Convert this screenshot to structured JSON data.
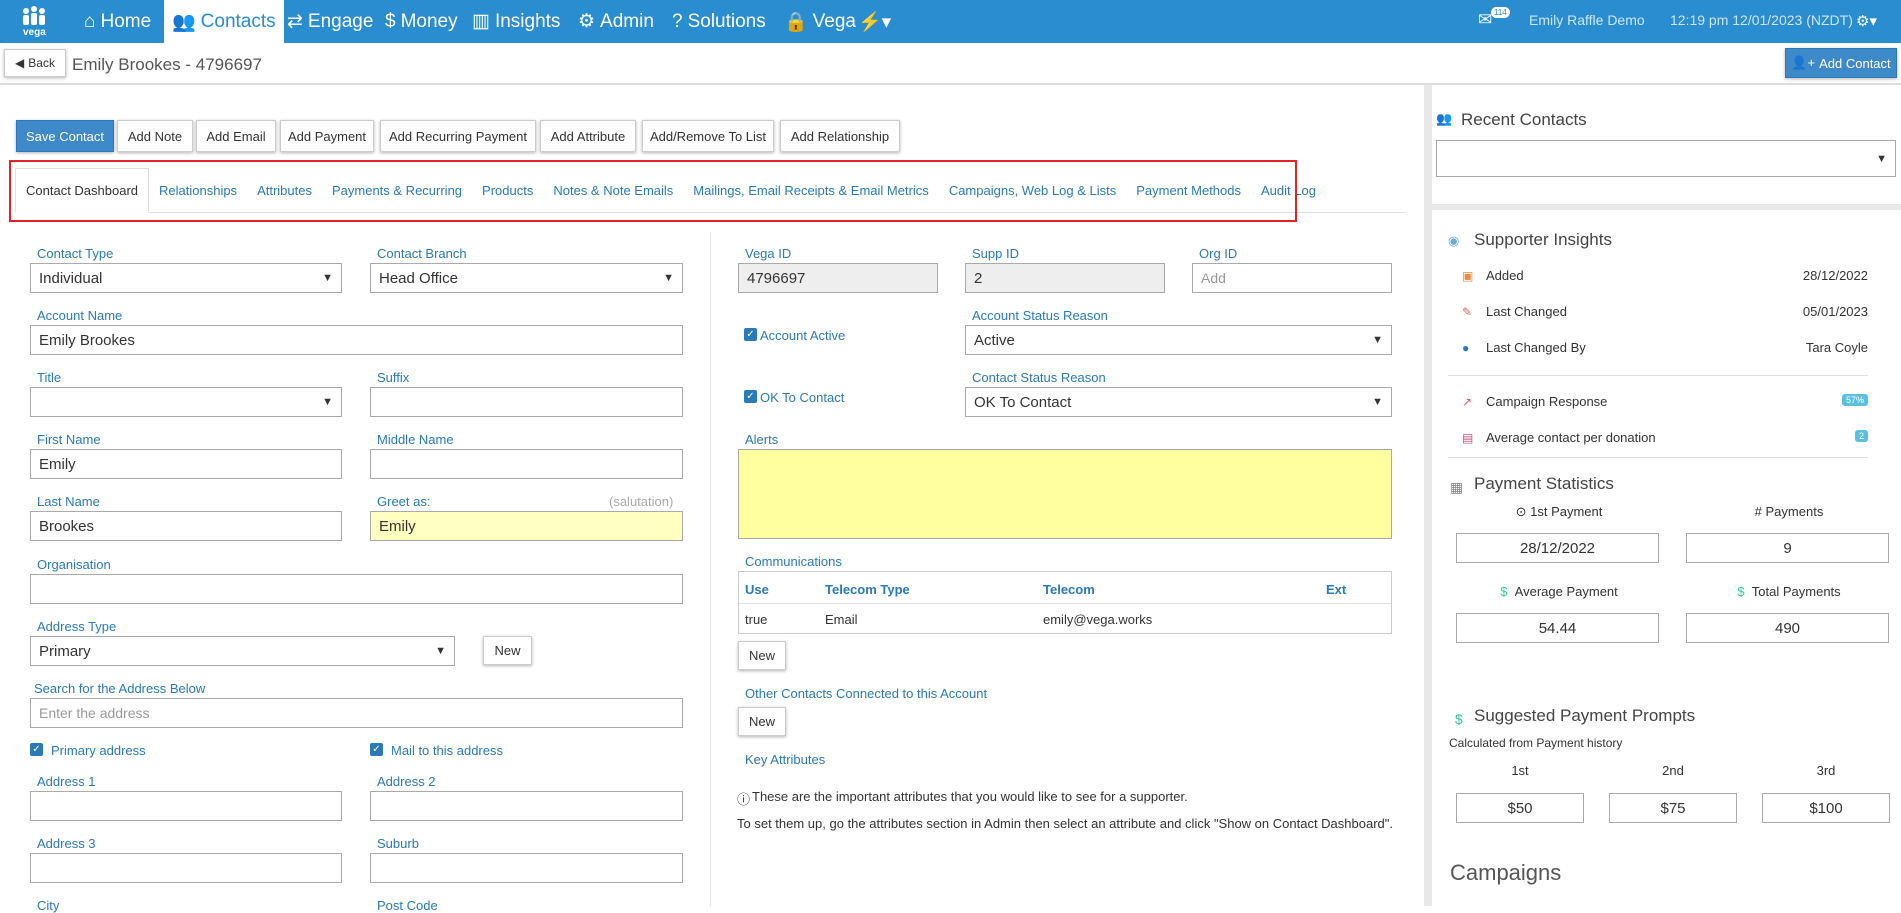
{
  "topnav": {
    "logo_text": "vega",
    "items": [
      {
        "label": "Home",
        "icon": "home-icon"
      },
      {
        "label": "Contacts",
        "icon": "users-icon"
      },
      {
        "label": "Engage",
        "icon": "exchange-icon"
      },
      {
        "label": "Money",
        "icon": "dollar-icon"
      },
      {
        "label": "Insights",
        "icon": "bar-chart-icon"
      },
      {
        "label": "Admin",
        "icon": "cogs-icon"
      },
      {
        "label": "Solutions",
        "icon": "question-icon"
      },
      {
        "label": "Vega",
        "icon": "lock-icon"
      }
    ],
    "notification_count": "114",
    "account_name": "Emily Raffle Demo",
    "datetime": "12:19 pm 12/01/2023 (NZDT)"
  },
  "subbar": {
    "back_label": "Back",
    "page_title": "Emily Brookes - 4796697",
    "add_contact_label": "Add Contact"
  },
  "actions": {
    "save_contact": "Save Contact",
    "add_note": "Add Note",
    "add_email": "Add Email",
    "add_payment": "Add Payment",
    "add_recurring_payment": "Add Recurring Payment",
    "add_attribute": "Add Attribute",
    "add_remove_list": "Add/Remove To List",
    "add_relationship": "Add Relationship"
  },
  "tabs": [
    "Contact Dashboard",
    "Relationships",
    "Attributes",
    "Payments & Recurring",
    "Products",
    "Notes & Note Emails",
    "Mailings, Email Receipts & Email Metrics",
    "Campaigns, Web Log & Lists",
    "Payment Methods",
    "Audit Log"
  ],
  "form": {
    "contact_type_label": "Contact Type",
    "contact_type_value": "Individual",
    "contact_branch_label": "Contact Branch",
    "contact_branch_value": "Head Office",
    "account_name_label": "Account Name",
    "account_name_value": "Emily Brookes",
    "title_label": "Title",
    "title_value": "",
    "suffix_label": "Suffix",
    "suffix_value": "",
    "first_name_label": "First Name",
    "first_name_value": "Emily",
    "middle_name_label": "Middle Name",
    "middle_name_value": "",
    "last_name_label": "Last Name",
    "last_name_value": "Brookes",
    "greet_as_label": "Greet as:",
    "greet_as_hint": "(salutation)",
    "greet_as_value": "Emily",
    "organisation_label": "Organisation",
    "organisation_value": "",
    "address_type_label": "Address Type",
    "address_type_value": "Primary",
    "new_label": "New",
    "search_address_label": "Search for the Address Below",
    "search_address_placeholder": "Enter the address",
    "primary_address_label": "Primary address",
    "mail_to_address_label": "Mail to this address",
    "address1_label": "Address 1",
    "address2_label": "Address 2",
    "address3_label": "Address 3",
    "suburb_label": "Suburb",
    "city_label": "City",
    "post_code_label": "Post Code"
  },
  "account": {
    "vega_id_label": "Vega ID",
    "vega_id_value": "4796697",
    "supp_id_label": "Supp ID",
    "supp_id_value": "2",
    "org_id_label": "Org ID",
    "org_id_placeholder": "Add",
    "account_active_label": "Account Active",
    "account_status_reason_label": "Account Status Reason",
    "account_status_reason_value": "Active",
    "ok_to_contact_label": "OK To Contact",
    "contact_status_reason_label": "Contact Status Reason",
    "contact_status_reason_value": "OK To Contact",
    "alerts_label": "Alerts",
    "communications_label": "Communications",
    "comm_headers": [
      "Use",
      "Telecom Type",
      "Telecom",
      "Ext"
    ],
    "comm_row": [
      "true",
      "Email",
      "emily@vega.works",
      ""
    ],
    "new_label": "New",
    "other_contacts_label": "Other Contacts Connected to this Account",
    "key_attributes_label": "Key Attributes",
    "key_attr_info": "These are the important attributes that you would like to see for a supporter.",
    "key_attr_help": "To set them up, go the attributes section in Admin then select an attribute and click \"Show on Contact Dashboard\"."
  },
  "sidebar": {
    "recent_contacts_title": "Recent Contacts",
    "recent_contacts_value": "",
    "supporter_insights_title": "Supporter Insights",
    "added_label": "Added",
    "added_value": "28/12/2022",
    "last_changed_label": "Last Changed",
    "last_changed_value": "05/01/2023",
    "last_changed_by_label": "Last Changed By",
    "last_changed_by_value": "Tara Coyle",
    "campaign_response_label": "Campaign Response",
    "campaign_response_value": "57%",
    "avg_contact_label": "Average contact per donation",
    "avg_contact_value": "2",
    "payment_statistics_title": "Payment Statistics",
    "first_payment_label": "1st Payment",
    "first_payment_value": "28/12/2022",
    "payments_label": "Payments",
    "payments_value": "9",
    "average_payment_label": "Average Payment",
    "average_payment_value": "54.44",
    "total_payments_label": "Total Payments",
    "total_payments_value": "490",
    "suggested_title": "Suggested Payment Prompts",
    "suggested_sub": "Calculated from Payment history",
    "prompt_labels": [
      "1st",
      "2nd",
      "3rd"
    ],
    "prompt_values": [
      "$50",
      "$75",
      "$100"
    ],
    "campaigns_title": "Campaigns"
  },
  "colors": {
    "brand_blue": "#2a8dcf",
    "link_blue": "#2a7ab8",
    "highlight_red": "#e02424",
    "alert_yellow": "#ffffa0"
  }
}
